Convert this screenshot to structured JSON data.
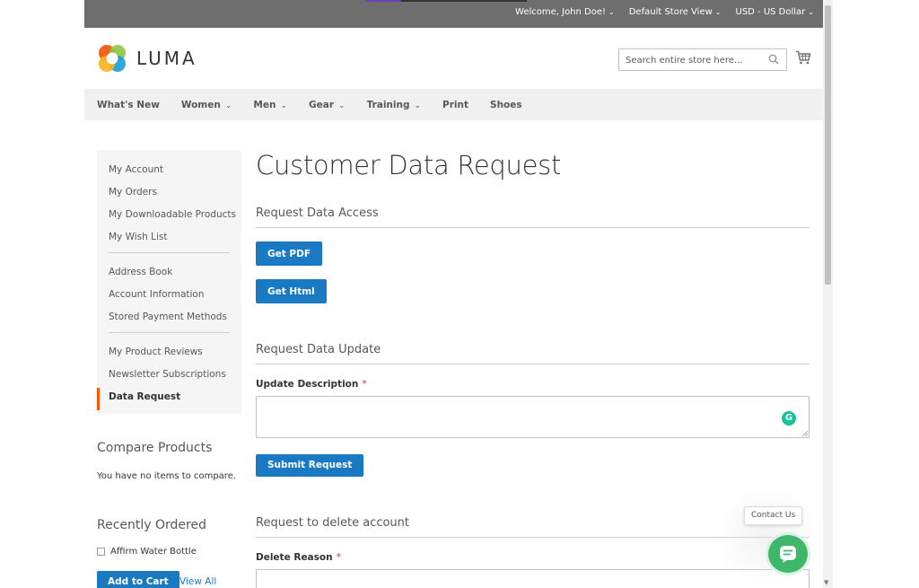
{
  "topbar": {
    "welcome": "Welcome, John Doe!",
    "store_view": "Default Store View",
    "currency": "USD - US Dollar"
  },
  "header": {
    "logo_text": "LUMA",
    "search_placeholder": "Search entire store here..."
  },
  "nav": {
    "items": [
      {
        "label": "What's New",
        "dropdown": false
      },
      {
        "label": "Women",
        "dropdown": true
      },
      {
        "label": "Men",
        "dropdown": true
      },
      {
        "label": "Gear",
        "dropdown": true
      },
      {
        "label": "Training",
        "dropdown": true
      },
      {
        "label": "Print",
        "dropdown": false
      },
      {
        "label": "Shoes",
        "dropdown": false
      }
    ]
  },
  "sidebar": {
    "group1": [
      "My Account",
      "My Orders",
      "My Downloadable Products",
      "My Wish List"
    ],
    "group2": [
      "Address Book",
      "Account Information",
      "Stored Payment Methods"
    ],
    "group3": [
      "My Product Reviews",
      "Newsletter Subscriptions"
    ],
    "active": "Data Request"
  },
  "compare": {
    "title": "Compare Products",
    "empty_text": "You have no items to compare."
  },
  "recent": {
    "title": "Recently Ordered",
    "item": "Affirm Water Bottle",
    "add_to_cart": "Add to Cart",
    "view_all": "View All"
  },
  "main": {
    "page_title": "Customer Data Request",
    "access_title": "Request Data Access",
    "get_pdf": "Get PDF",
    "get_html": "Get Html",
    "update_title": "Request Data Update",
    "update_label": "Update Description",
    "required_mark": "*",
    "submit": "Submit Request",
    "delete_title": "Request to delete account",
    "delete_label": "Delete Reason"
  },
  "widget": {
    "contact": "Contact Us",
    "grammarly_letter": "G"
  },
  "colors": {
    "primary": "#1979c3",
    "active_border": "#ff5501",
    "required": "#e02b27",
    "chat": "#3fb76a"
  }
}
